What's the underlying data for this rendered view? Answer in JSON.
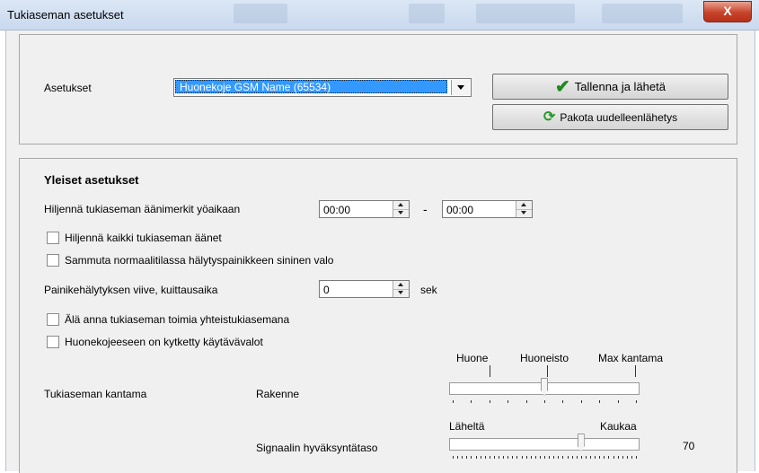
{
  "window": {
    "title": "Tukiaseman asetukset",
    "close_label": "X"
  },
  "settings": {
    "label": "Asetukset",
    "selected": "Huonekoje GSM Name (65534)",
    "save_label": "Tallenna ja lähetä",
    "force_label": "Pakota uudelleenlähetys"
  },
  "general": {
    "heading": "Yleiset asetukset",
    "silence_label": "Hiljennä tukiaseman äänimerkit yöaikaan",
    "silence_from": "00:00",
    "dash": "-",
    "silence_to": "00:00",
    "mute_all_label": "Hiljennä kaikki tukiaseman äänet",
    "blue_light_label": "Sammuta normaalitilassa hälytyspainikkeen sininen valo",
    "delay_label": "Painikehälytyksen viive, kuittausaika",
    "delay_value": "0",
    "delay_unit": "sek",
    "no_common_label": "Älä anna tukiaseman toimia yhteistukiasemana",
    "corridor_label": "Huonekojeeseen on kytketty käytävävalot"
  },
  "range": {
    "label": "Tukiaseman kantama",
    "structure_label": "Rakenne",
    "structure_marks": [
      "Huone",
      "Huoneisto",
      "Max kantama"
    ],
    "structure_level": 0.5,
    "signal_label": "Signaalin hyväksyntätaso",
    "signal_near": "Läheltä",
    "signal_far": "Kaukaa",
    "signal_value": "70",
    "signal_level": 0.7
  }
}
